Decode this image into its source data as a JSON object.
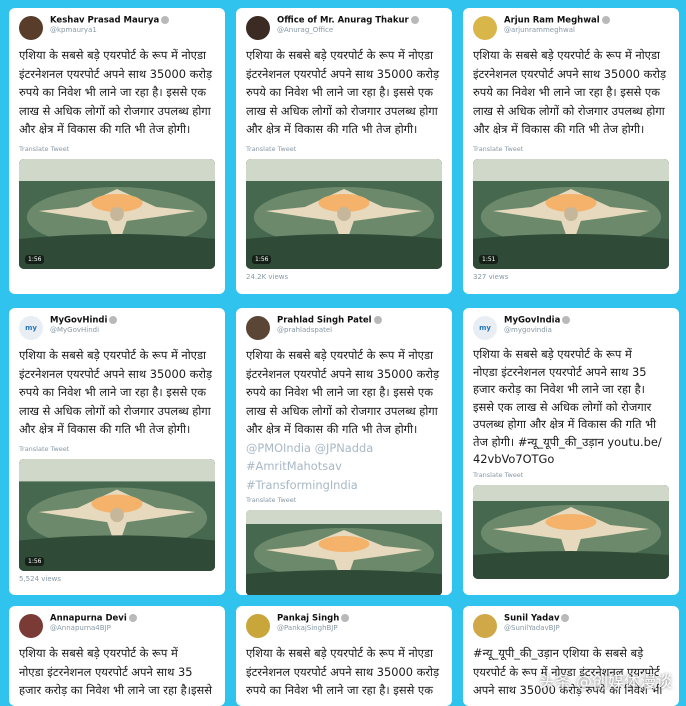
{
  "tweets": [
    {
      "name": "Keshav Prasad Maurya",
      "handle": "@kpmaurya1",
      "avatar": "KM",
      "avatar_color": "#5a3c2a",
      "lines": [
        "एशिया के सबसे बड़े एयरपोर्ट के रूप में नोएडा",
        "इंटरनेशनल एयरपोर्ट अपने साथ 35000 करोड़",
        "रुपये का निवेश भी लाने जा रहा है। इससे एक",
        "लाख से अधिक लोगों को रोजगार उपलब्ध होगा",
        "और क्षेत्र में विकास की गति भी तेज होगी।"
      ],
      "tags": [],
      "translate": "Translate Tweet",
      "duration": "1:56",
      "views": ""
    },
    {
      "name": "Office of Mr. Anurag Thakur",
      "handle": "@Anurag_Office",
      "avatar": "AT",
      "avatar_color": "#3b2b22",
      "lines": [
        "एशिया के सबसे बड़े एयरपोर्ट के रूप में नोएडा",
        "इंटरनेशनल एयरपोर्ट अपने साथ 35000 करोड़",
        "रुपये का निवेश भी लाने जा रहा है। इससे एक",
        "लाख से अधिक लोगों को रोजगार उपलब्ध होगा",
        "और क्षेत्र में विकास की गति भी तेज होगी।"
      ],
      "tags": [],
      "translate": "Translate Tweet",
      "duration": "1:56",
      "views": "24.2K views"
    },
    {
      "name": "Arjun Ram Meghwal",
      "handle": "@arjunrammeghwal",
      "avatar": "AM",
      "avatar_color": "#d9b64a",
      "lines": [
        "एशिया के सबसे बड़े एयरपोर्ट के रूप में नोएडा",
        "इंटरनेशनल एयरपोर्ट अपने साथ 35000 करोड़",
        "रुपये का निवेश भी लाने जा रहा है। इससे एक",
        "लाख से अधिक लोगों को रोजगार उपलब्ध होगा",
        "और क्षेत्र में विकास की गति भी तेज होगी।"
      ],
      "tags": [],
      "translate": "Translate Tweet",
      "duration": "1:51",
      "views": "327 views"
    },
    {
      "name": "MyGovHindi",
      "handle": "@MyGovHindi",
      "avatar": "my​Gov",
      "avatar_color": "#e8eef3",
      "lines": [
        "एशिया के सबसे बड़े एयरपोर्ट के रूप में नोएडा",
        "इंटरनेशनल एयरपोर्ट अपने साथ 35000 करोड़",
        "रुपये का निवेश भी लाने जा रहा है। इससे एक",
        "लाख से अधिक लोगों को रोजगार उपलब्ध होगा",
        "और क्षेत्र में विकास की गति भी तेज होगी।"
      ],
      "tags": [],
      "translate": "Translate Tweet",
      "duration": "1:56",
      "views": "5,524 views"
    },
    {
      "name": "Prahlad Singh Patel",
      "handle": "@prahladspatel",
      "avatar": "PP",
      "avatar_color": "#5b4535",
      "lines": [
        "एशिया के सबसे बड़े एयरपोर्ट के रूप में नोएडा",
        "इंटरनेशनल एयरपोर्ट अपने साथ 35000 करोड़",
        "रुपये का निवेश भी लाने जा रहा है। इससे एक",
        "लाख से अधिक लोगों को रोजगार उपलब्ध होगा",
        "और क्षेत्र में विकास की गति भी तेज होगी।"
      ],
      "tags": [
        "@PMOIndia @JPNadda",
        "#AmritMahotsav",
        "#TransformingIndia"
      ],
      "translate": "Translate Tweet",
      "duration": "",
      "views": ""
    },
    {
      "name": "MyGovIndia",
      "handle": "@mygovindia",
      "avatar": "my​Gov",
      "avatar_color": "#e8eef3",
      "lines": [
        "एशिया के सबसे बड़े एयरपोर्ट के रूप में",
        "नोएडा इंटरनेशनल एयरपोर्ट अपने साथ 35",
        "हजार करोड़ का निवेश भी लाने जा रहा है।",
        "इससे एक लाख से अधिक लोगों को रोजगार",
        "उपलब्ध होगा और क्षेत्र में विकास की गति भी",
        "तेज होगी। #न्यू_यूपी_की_उड़ान youtu.be/",
        "42vbVo7OTGo"
      ],
      "tags": [],
      "translate": "Translate Tweet",
      "duration": "",
      "views": ""
    },
    {
      "name": "Annapurna Devi",
      "handle": "@Annapurna4BJP",
      "avatar": "AD",
      "avatar_color": "#7a3b36",
      "lines": [
        "एशिया के सबसे बड़े एयरपोर्ट के रूप में",
        "नोएडा इंटरनेशनल एयरपोर्ट अपने साथ 35",
        "हजार करोड़ का निवेश भी लाने जा रहा है।इससे"
      ],
      "tags": [],
      "translate": "",
      "duration": "",
      "views": ""
    },
    {
      "name": "Pankaj Singh",
      "handle": "@PankajSinghBJP",
      "avatar": "PS",
      "avatar_color": "#c8a63a",
      "lines": [
        "एशिया के सबसे बड़े एयरपोर्ट के रूप में नोएडा",
        "इंटरनेशनल एयरपोर्ट अपने साथ 35000 करोड़",
        "रुपये का निवेश भी लाने जा रहा है। इससे एक"
      ],
      "tags": [],
      "translate": "",
      "duration": "",
      "views": ""
    },
    {
      "name": "Sunil Yadav",
      "handle": "@SunilYadavBJP",
      "avatar": "SY",
      "avatar_color": "#d0a848",
      "lines": [
        "#न्यू_यूपी_की_उड़ान एशिया के सबसे बड़े",
        "एयरपोर्ट के रूप में नोएडा इंटरनेशनल एयरपोर्ट",
        "अपने साथ 35000 करोड़ रुपये का निवेश भी"
      ],
      "tags": [],
      "translate": "",
      "duration": "",
      "views": ""
    }
  ],
  "watermark": "头条 @创媒体漫谈"
}
